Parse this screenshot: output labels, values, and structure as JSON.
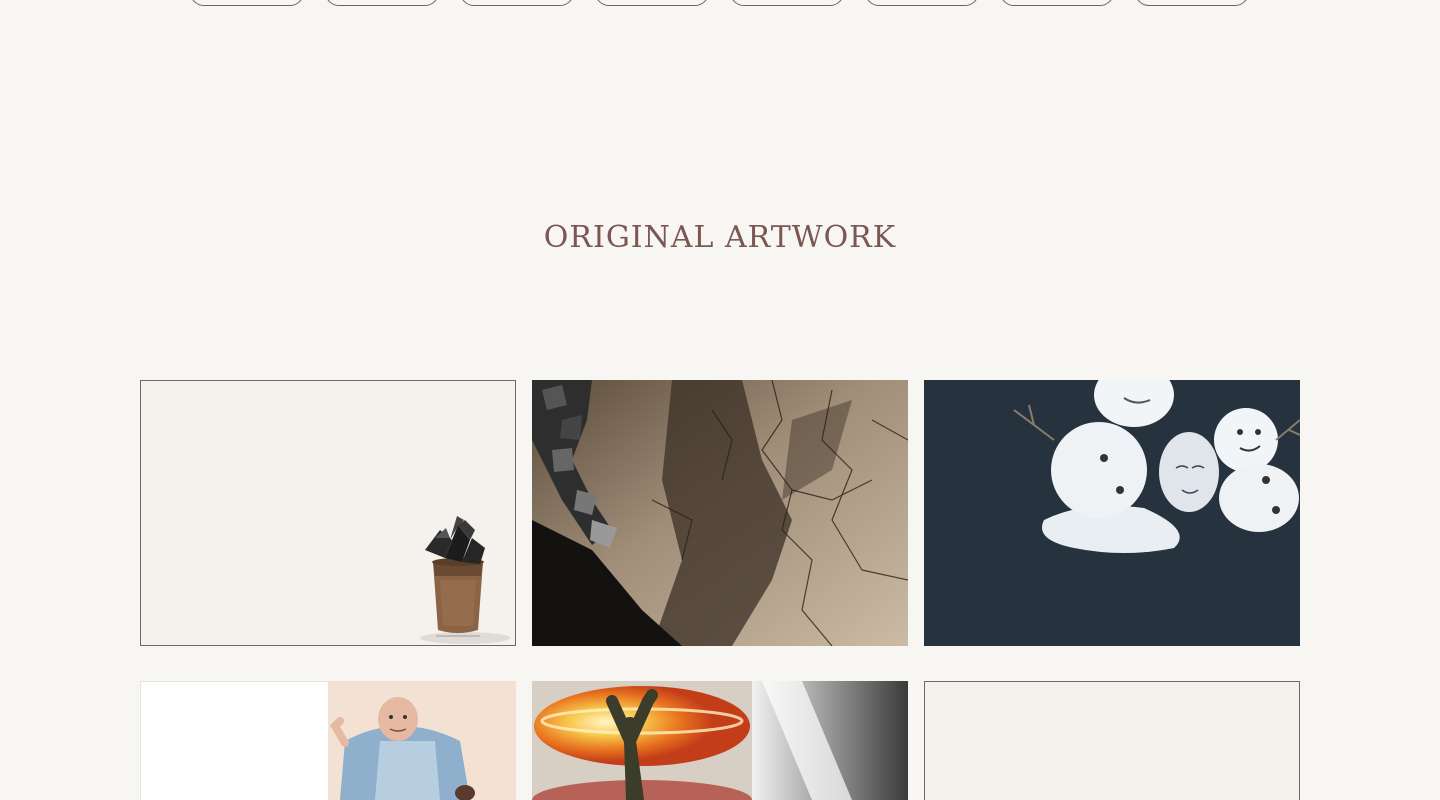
{
  "section": {
    "title": "ORIGINAL ARTWORK"
  },
  "colors": {
    "page_background": "#f7f6f2",
    "title_color": "#7a5752",
    "pill_border": "#7a5f57",
    "tile_border": "#6b6a66",
    "snow_scene_bg": "#26323d"
  },
  "filter_pills": [
    {
      "label": ""
    },
    {
      "label": ""
    },
    {
      "label": ""
    },
    {
      "label": ""
    },
    {
      "label": ""
    },
    {
      "label": ""
    },
    {
      "label": ""
    },
    {
      "label": ""
    }
  ],
  "artworks": [
    {
      "name": "artwork-trash-bin-rocks"
    },
    {
      "name": "artwork-cracked-wall-shadow"
    },
    {
      "name": "artwork-melting-snowmen"
    },
    {
      "name": "artwork-butcher-man"
    },
    {
      "name": "artwork-explosion-figure"
    },
    {
      "name": "artwork-blank-frame"
    }
  ]
}
